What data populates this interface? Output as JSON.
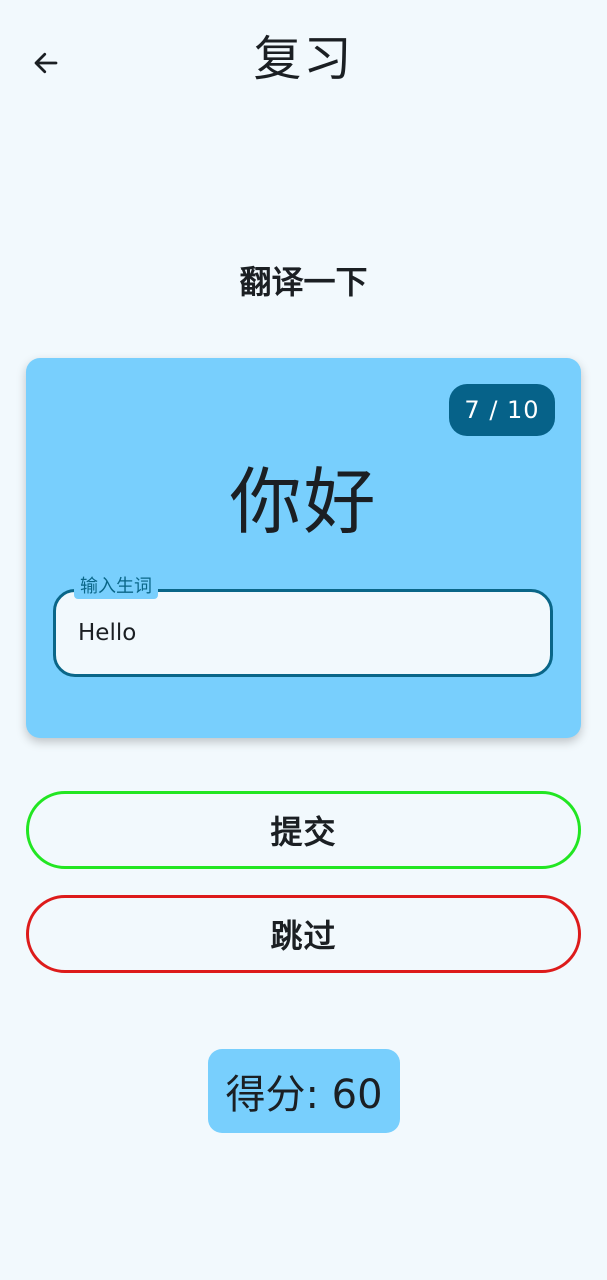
{
  "app_bar": {
    "back_icon": "arrow-left-icon",
    "title": "复习"
  },
  "quiz": {
    "prompt": "翻译一下",
    "progress": "7 / 10",
    "word": "你好",
    "answer_field": {
      "label": "输入生词",
      "value": "Hello"
    }
  },
  "actions": {
    "submit_label": "提交",
    "skip_label": "跳过"
  },
  "score": {
    "text": "得分: 60"
  },
  "colors": {
    "background": "#f2f9fd",
    "card": "#78cffd",
    "accent": "#066289",
    "submit_border": "#22e622",
    "skip_border": "#dd1b1b"
  }
}
